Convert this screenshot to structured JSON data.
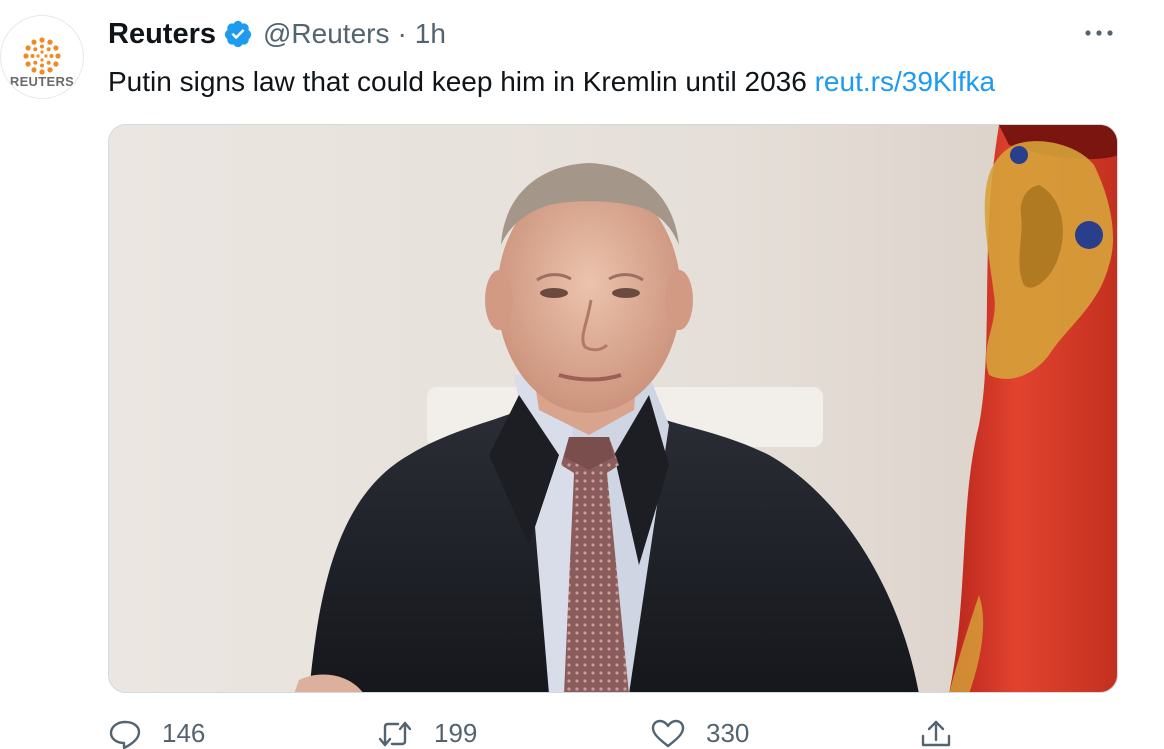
{
  "account": {
    "name": "Reuters",
    "handle": "@Reuters",
    "separator": "·",
    "time": "1h",
    "verified_color": "#1d9bf0",
    "avatar_label": "REUTERS",
    "avatar_brand_color": "#f08a24"
  },
  "tweet": {
    "text": "Putin signs law that could keep him in Kremlin until 2036",
    "link": "reut.rs/39Klfka"
  },
  "actions": {
    "reply_count": "146",
    "retweet_count": "199",
    "like_count": "330"
  },
  "icons": {
    "more": "more-horizontal-icon",
    "reply": "reply-icon",
    "retweet": "retweet-icon",
    "like": "heart-icon",
    "share": "share-icon",
    "verified": "verified-badge-icon"
  },
  "colors": {
    "text_primary": "#0f1419",
    "text_secondary": "#536471",
    "link": "#1d9bf0"
  }
}
